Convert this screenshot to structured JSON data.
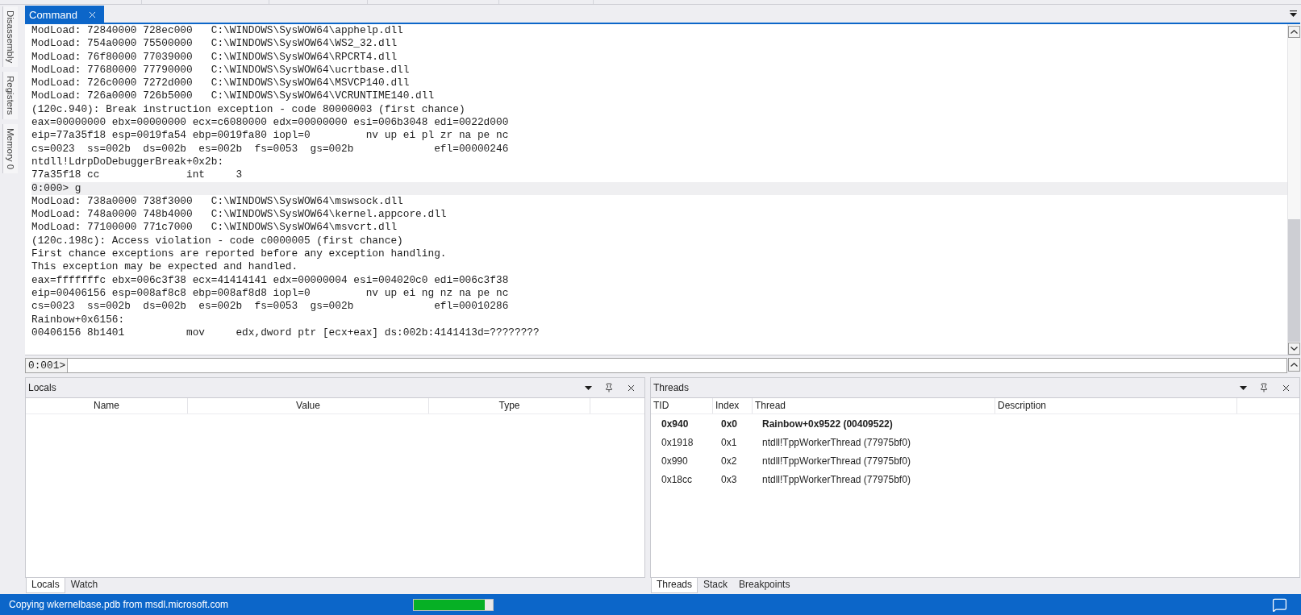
{
  "side_tabs": [
    {
      "label": "Disassembly",
      "selected": false
    },
    {
      "label": "Registers",
      "selected": false
    },
    {
      "label": "Memory 0",
      "selected": false
    }
  ],
  "document_tabs": [
    {
      "label": "Command",
      "selected": true
    }
  ],
  "command_window": {
    "lines": [
      {
        "kind": "output",
        "text": "ModLoad: 72840000 728ec000   C:\\WINDOWS\\SysWOW64\\apphelp.dll"
      },
      {
        "kind": "output",
        "text": "ModLoad: 754a0000 75500000   C:\\WINDOWS\\SysWOW64\\WS2_32.dll"
      },
      {
        "kind": "output",
        "text": "ModLoad: 76f80000 77039000   C:\\WINDOWS\\SysWOW64\\RPCRT4.dll"
      },
      {
        "kind": "output",
        "text": "ModLoad: 77680000 77790000   C:\\WINDOWS\\SysWOW64\\ucrtbase.dll"
      },
      {
        "kind": "output",
        "text": "ModLoad: 726c0000 7272d000   C:\\WINDOWS\\SysWOW64\\MSVCP140.dll"
      },
      {
        "kind": "output",
        "text": "ModLoad: 726a0000 726b5000   C:\\WINDOWS\\SysWOW64\\VCRUNTIME140.dll"
      },
      {
        "kind": "output",
        "text": "(120c.940): Break instruction exception - code 80000003 (first chance)"
      },
      {
        "kind": "output",
        "text": "eax=00000000 ebx=00000000 ecx=c6080000 edx=00000000 esi=006b3048 edi=0022d000"
      },
      {
        "kind": "output",
        "text": "eip=77a35f18 esp=0019fa54 ebp=0019fa80 iopl=0         nv up ei pl zr na pe nc"
      },
      {
        "kind": "output",
        "text": "cs=0023  ss=002b  ds=002b  es=002b  fs=0053  gs=002b             efl=00000246"
      },
      {
        "kind": "output",
        "text": "ntdll!LdrpDoDebuggerBreak+0x2b:"
      },
      {
        "kind": "output",
        "text": "77a35f18 cc              int     3"
      },
      {
        "kind": "command",
        "text": "0:000> g"
      },
      {
        "kind": "output",
        "text": "ModLoad: 738a0000 738f3000   C:\\WINDOWS\\SysWOW64\\mswsock.dll"
      },
      {
        "kind": "output",
        "text": "ModLoad: 748a0000 748b4000   C:\\WINDOWS\\SysWOW64\\kernel.appcore.dll"
      },
      {
        "kind": "output",
        "text": "ModLoad: 77100000 771c7000   C:\\WINDOWS\\SysWOW64\\msvcrt.dll"
      },
      {
        "kind": "output",
        "text": "(120c.198c): Access violation - code c0000005 (first chance)"
      },
      {
        "kind": "output",
        "text": "First chance exceptions are reported before any exception handling."
      },
      {
        "kind": "output",
        "text": "This exception may be expected and handled."
      },
      {
        "kind": "output",
        "text": "eax=fffffffc ebx=006c3f38 ecx=41414141 edx=00000004 esi=004020c0 edi=006c3f38"
      },
      {
        "kind": "output",
        "text": "eip=00406156 esp=008af8c8 ebp=008af8d8 iopl=0         nv up ei ng nz na pe nc"
      },
      {
        "kind": "output",
        "text": "cs=0023  ss=002b  ds=002b  es=002b  fs=0053  gs=002b             efl=00010286"
      },
      {
        "kind": "output",
        "text": "Rainbow+0x6156:"
      },
      {
        "kind": "output",
        "text": "00406156 8b1401          mov     edx,dword ptr [ecx+eax] ds:002b:4141413d=????????"
      }
    ],
    "prompt": "0:001>"
  },
  "locals_panel": {
    "title": "Locals",
    "columns": [
      "Name",
      "Value",
      "Type"
    ],
    "tabs": [
      {
        "label": "Locals",
        "selected": true
      },
      {
        "label": "Watch",
        "selected": false
      }
    ]
  },
  "threads_panel": {
    "title": "Threads",
    "columns": [
      "TID",
      "Index",
      "Thread",
      "Description"
    ],
    "rows": [
      {
        "tid": "0x940",
        "index": "0x0",
        "thread": "Rainbow+0x9522 (00409522)",
        "current": true
      },
      {
        "tid": "0x1918",
        "index": "0x1",
        "thread": "ntdll!TppWorkerThread (77975bf0)",
        "current": false
      },
      {
        "tid": "0x990",
        "index": "0x2",
        "thread": "ntdll!TppWorkerThread (77975bf0)",
        "current": false
      },
      {
        "tid": "0x18cc",
        "index": "0x3",
        "thread": "ntdll!TppWorkerThread (77975bf0)",
        "current": false
      }
    ],
    "tabs": [
      {
        "label": "Threads",
        "selected": true
      },
      {
        "label": "Stack",
        "selected": false
      },
      {
        "label": "Breakpoints",
        "selected": false
      }
    ]
  },
  "status_bar": {
    "message": "Copying wkernelbase.pdb from msdl.microsoft.com",
    "progress": {
      "level": 0.9
    }
  }
}
